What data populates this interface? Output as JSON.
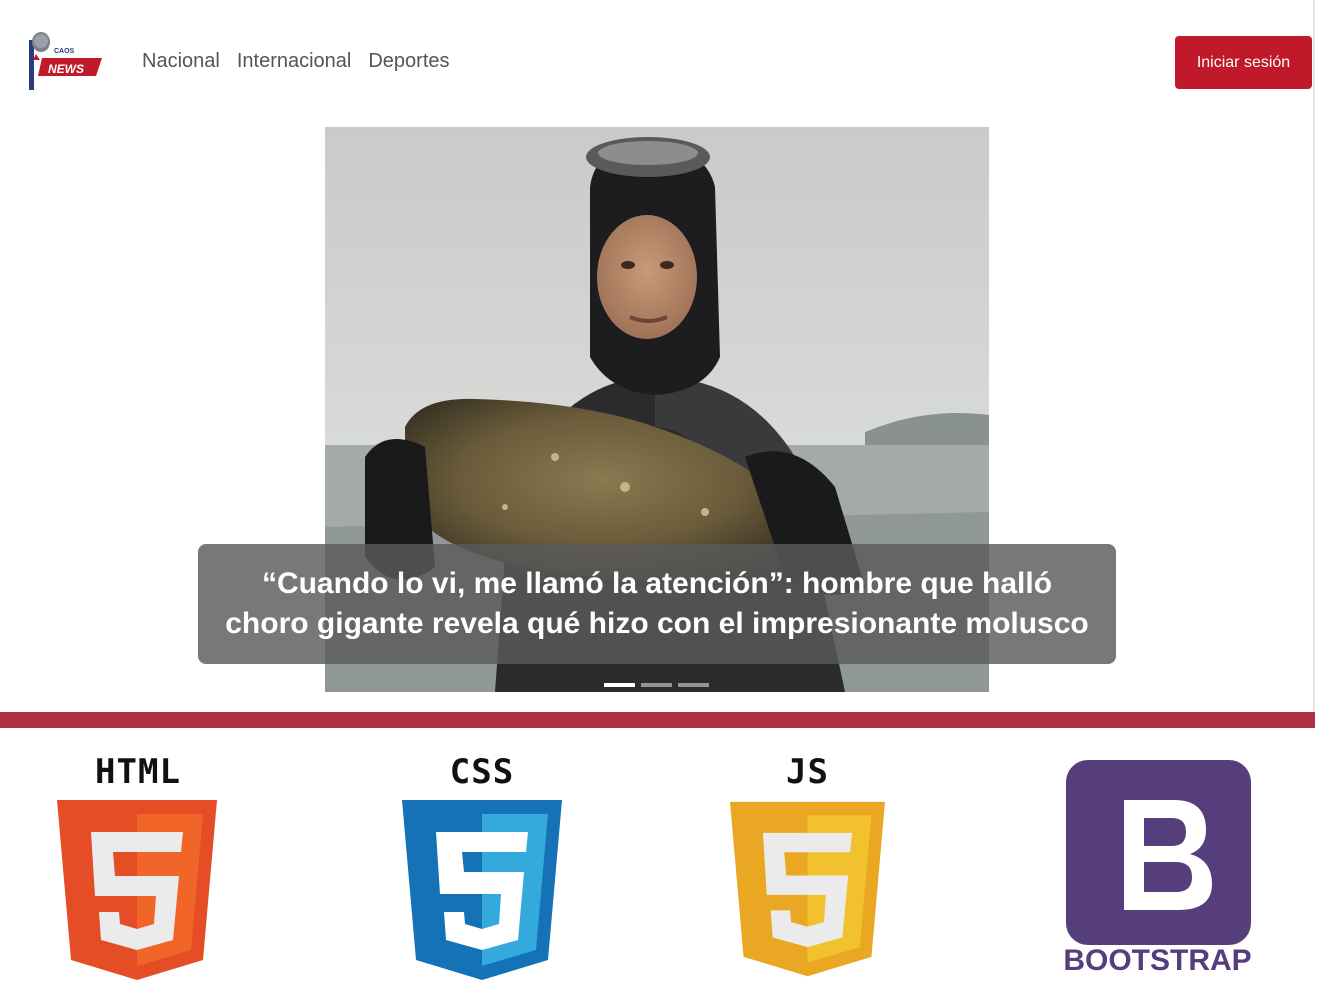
{
  "header": {
    "logo": {
      "icon": "caos-news-logo-icon",
      "text_top": "CAOS",
      "text_bottom": "NEWS"
    },
    "nav": [
      {
        "label": "Nacional"
      },
      {
        "label": "Internacional"
      },
      {
        "label": "Deportes"
      }
    ],
    "login_label": "Iniciar sesión",
    "colors": {
      "accent": "#c0192a",
      "divider": "#b03042"
    }
  },
  "carousel": {
    "image": "diver-holding-giant-mussel-photo",
    "caption": "“Cuando lo vi, me llamó la atención”: hombre que halló choro gigante revela qué hizo con el impresionante molusco",
    "slides": 3,
    "active_slide": 1
  },
  "tech": [
    {
      "label": "HTML",
      "icon": "html5-shield-icon",
      "color": "#e44d26"
    },
    {
      "label": "CSS",
      "icon": "css3-shield-icon",
      "color": "#1572b6"
    },
    {
      "label": "JS",
      "icon": "js-shield-icon",
      "color": "#e9a723"
    },
    {
      "label": "BOOTSTRAP",
      "icon": "bootstrap-icon",
      "color": "#563d7c"
    }
  ]
}
